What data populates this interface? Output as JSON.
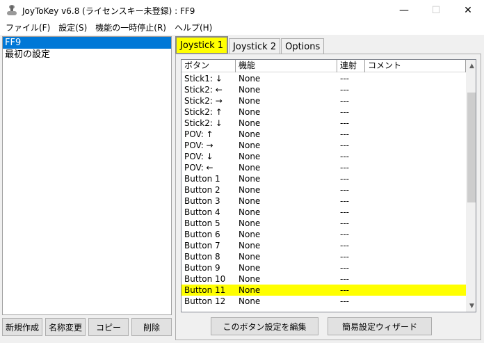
{
  "window": {
    "title": "JoyToKey v6.8 (ライセンスキー未登録) : FF9",
    "minimize": "—",
    "maximize": "☐",
    "close": "✕"
  },
  "menu": [
    "ファイル(F)",
    "設定(S)",
    "機能の一時停止(R)",
    "ヘルプ(H)"
  ],
  "profiles": [
    "FF9",
    "最初の設定"
  ],
  "profile_buttons": {
    "new": "新規作成",
    "rename": "名称変更",
    "copy": "コピー",
    "delete": "削除"
  },
  "tabs": [
    "Joystick 1",
    "Joystick 2",
    "Options"
  ],
  "table": {
    "headers": [
      "ボタン",
      "機能",
      "連射",
      "コメント"
    ],
    "rows": [
      {
        "button": "Stick1: ↓",
        "function": "None",
        "rapid": "---",
        "comment": ""
      },
      {
        "button": "Stick2: ←",
        "function": "None",
        "rapid": "---",
        "comment": ""
      },
      {
        "button": "Stick2: →",
        "function": "None",
        "rapid": "---",
        "comment": ""
      },
      {
        "button": "Stick2: ↑",
        "function": "None",
        "rapid": "---",
        "comment": ""
      },
      {
        "button": "Stick2: ↓",
        "function": "None",
        "rapid": "---",
        "comment": ""
      },
      {
        "button": "POV: ↑",
        "function": "None",
        "rapid": "---",
        "comment": ""
      },
      {
        "button": "POV: →",
        "function": "None",
        "rapid": "---",
        "comment": ""
      },
      {
        "button": "POV: ↓",
        "function": "None",
        "rapid": "---",
        "comment": ""
      },
      {
        "button": "POV: ←",
        "function": "None",
        "rapid": "---",
        "comment": ""
      },
      {
        "button": "Button 1",
        "function": "None",
        "rapid": "---",
        "comment": ""
      },
      {
        "button": "Button 2",
        "function": "None",
        "rapid": "---",
        "comment": ""
      },
      {
        "button": "Button 3",
        "function": "None",
        "rapid": "---",
        "comment": ""
      },
      {
        "button": "Button 4",
        "function": "None",
        "rapid": "---",
        "comment": ""
      },
      {
        "button": "Button 5",
        "function": "None",
        "rapid": "---",
        "comment": ""
      },
      {
        "button": "Button 6",
        "function": "None",
        "rapid": "---",
        "comment": ""
      },
      {
        "button": "Button 7",
        "function": "None",
        "rapid": "---",
        "comment": ""
      },
      {
        "button": "Button 8",
        "function": "None",
        "rapid": "---",
        "comment": ""
      },
      {
        "button": "Button 9",
        "function": "None",
        "rapid": "---",
        "comment": ""
      },
      {
        "button": "Button 10",
        "function": "None",
        "rapid": "---",
        "comment": ""
      },
      {
        "button": "Button 11",
        "function": "None",
        "rapid": "---",
        "comment": ""
      },
      {
        "button": "Button 12",
        "function": "None",
        "rapid": "---",
        "comment": ""
      }
    ]
  },
  "actions": {
    "edit": "このボタン設定を編集",
    "wizard": "簡易設定ウィザード"
  },
  "colors": {
    "selection": "#0078d7",
    "highlight": "#ffff00"
  }
}
